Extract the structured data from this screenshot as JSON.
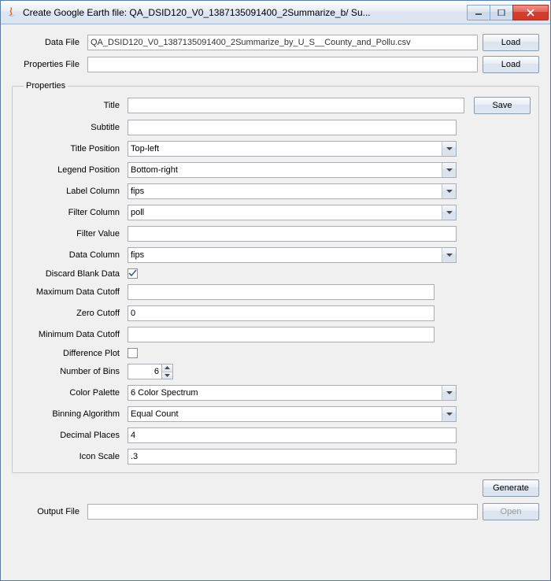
{
  "window": {
    "title": "Create Google Earth file: QA_DSID120_V0_1387135091400_2Summarize_b/ Su..."
  },
  "top": {
    "data_file_label": "Data File",
    "data_file_value": "QA_DSID120_V0_1387135091400_2Summarize_by_U_S__County_and_Pollu.csv",
    "properties_file_label": "Properties File",
    "properties_file_value": "",
    "load_label": "Load"
  },
  "fieldset": {
    "legend": "Properties",
    "save_label": "Save",
    "rows": {
      "title_label": "Title",
      "title_value": "",
      "subtitle_label": "Subtitle",
      "subtitle_value": "",
      "title_position_label": "Title Position",
      "title_position_value": "Top-left",
      "legend_position_label": "Legend Position",
      "legend_position_value": "Bottom-right",
      "label_column_label": "Label Column",
      "label_column_value": "fips",
      "filter_column_label": "Filter Column",
      "filter_column_value": "poll",
      "filter_value_label": "Filter Value",
      "filter_value_value": "",
      "data_column_label": "Data Column",
      "data_column_value": "fips",
      "discard_blank_label": "Discard Blank Data",
      "discard_blank_checked": true,
      "max_cutoff_label": "Maximum Data Cutoff",
      "max_cutoff_value": "",
      "zero_cutoff_label": "Zero Cutoff",
      "zero_cutoff_value": "0",
      "min_cutoff_label": "Minimum Data Cutoff",
      "min_cutoff_value": "",
      "difference_plot_label": "Difference Plot",
      "difference_plot_checked": false,
      "num_bins_label": "Number of Bins",
      "num_bins_value": "6",
      "color_palette_label": "Color Palette",
      "color_palette_value": "6 Color Spectrum",
      "binning_algo_label": "Binning Algorithm",
      "binning_algo_value": "Equal Count",
      "decimal_places_label": "Decimal Places",
      "decimal_places_value": "4",
      "icon_scale_label": "Icon Scale",
      "icon_scale_value": ".3"
    }
  },
  "bottom": {
    "generate_label": "Generate",
    "output_file_label": "Output File",
    "output_file_value": "",
    "open_label": "Open"
  }
}
